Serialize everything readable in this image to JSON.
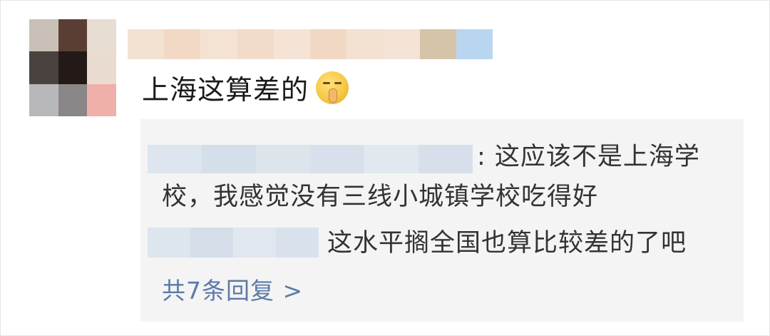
{
  "comment": {
    "text": "上海这算差的",
    "emoji_icon": "shushing-face-emoji"
  },
  "replies": [
    {
      "line1": ": 这应该不是上海学",
      "line2": "校，我感觉没有三线小城镇学校吃得好"
    },
    {
      "line1": "这水平搁全国也算比较差的了吧"
    }
  ],
  "more_replies_label": "共7条回复 >",
  "colors": {
    "link": "#5b7aa8",
    "reply_bg": "#f4f4f4",
    "text": "#1a1a1a"
  }
}
